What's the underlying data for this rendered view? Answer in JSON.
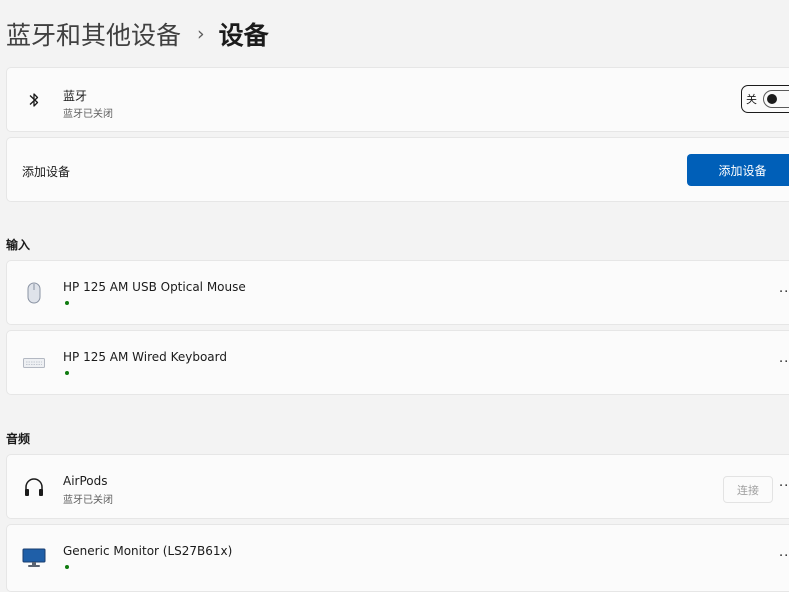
{
  "breadcrumb": {
    "parent": "蓝牙和其他设备",
    "separator": "›",
    "current": "设备"
  },
  "bluetooth": {
    "title": "蓝牙",
    "status": "蓝牙已关闭",
    "toggle_label": "关",
    "toggle_on": false,
    "icon": "bluetooth-icon"
  },
  "add_device": {
    "label": "添加设备",
    "button_label": "添加设备",
    "accent": "#005fb8"
  },
  "sections": {
    "input": "输入",
    "audio": "音频"
  },
  "input_devices": [
    {
      "name": "HP 125 AM USB Optical Mouse",
      "icon": "mouse-icon",
      "status_color": "#0f7b0f"
    },
    {
      "name": "HP 125 AM Wired Keyboard",
      "icon": "keyboard-icon",
      "status_color": "#0f7b0f"
    }
  ],
  "audio_devices": [
    {
      "name": "AirPods",
      "subtitle": "蓝牙已关闭",
      "icon": "headphones-icon",
      "connect_label": "连接"
    },
    {
      "name": "Generic Monitor (LS27B61x)",
      "icon": "monitor-icon",
      "status_color": "#0f7b0f"
    }
  ],
  "more_label": "···"
}
